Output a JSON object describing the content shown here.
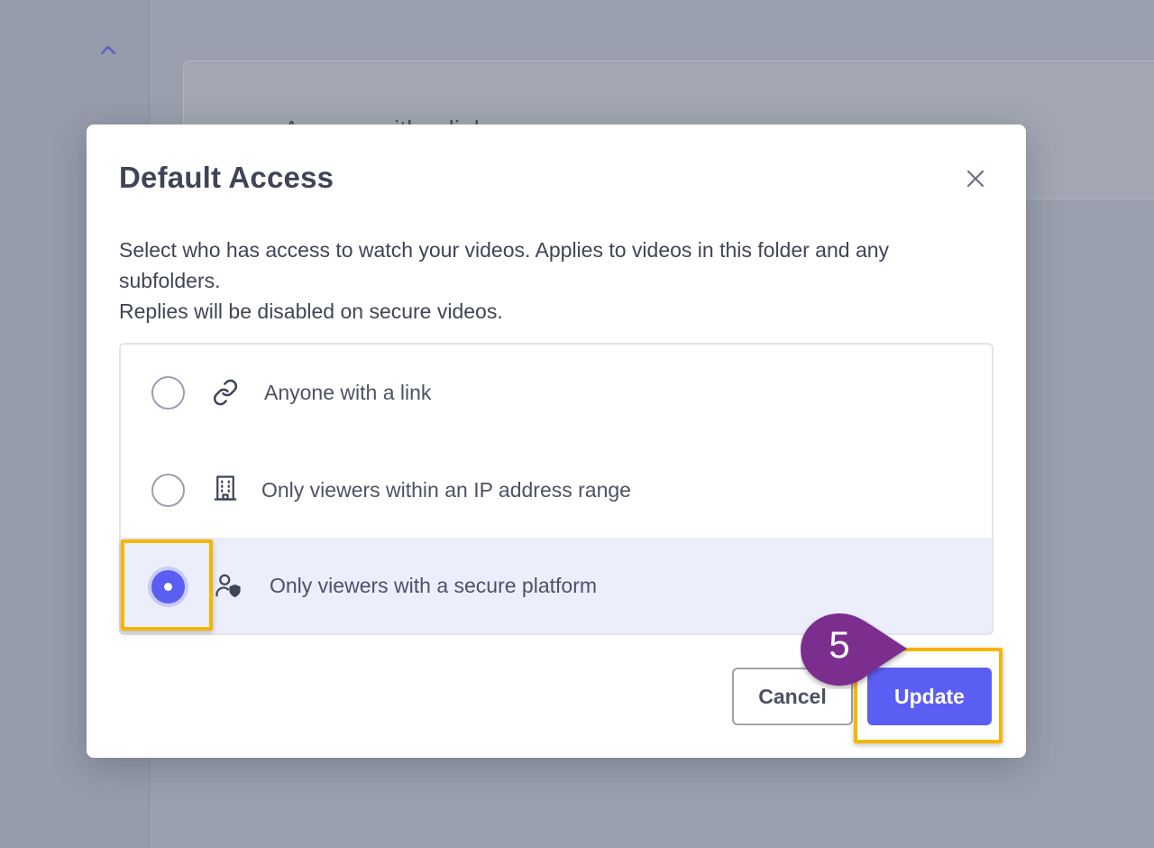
{
  "background": {
    "panel_text": "Anyone with a link"
  },
  "modal": {
    "title": "Default Access",
    "description_line1": "Select who has access to watch your videos. Applies to videos in this folder and any subfolders.",
    "description_line2": "Replies will be disabled on secure videos.",
    "options": [
      {
        "label": "Anyone with a link",
        "icon": "link-icon",
        "selected": false
      },
      {
        "label": "Only viewers within an IP address range",
        "icon": "building-icon",
        "selected": false
      },
      {
        "label": "Only viewers with a secure platform",
        "icon": "user-shield-icon",
        "selected": true
      }
    ],
    "cancel_label": "Cancel",
    "update_label": "Update"
  },
  "tutorial": {
    "step_number": "5",
    "badge_color": "#7b2f8f",
    "highlight_color": "#f7b500"
  },
  "colors": {
    "accent": "#5b5ef2",
    "selected_row_bg": "#eceefc",
    "text": "#3f4557"
  }
}
